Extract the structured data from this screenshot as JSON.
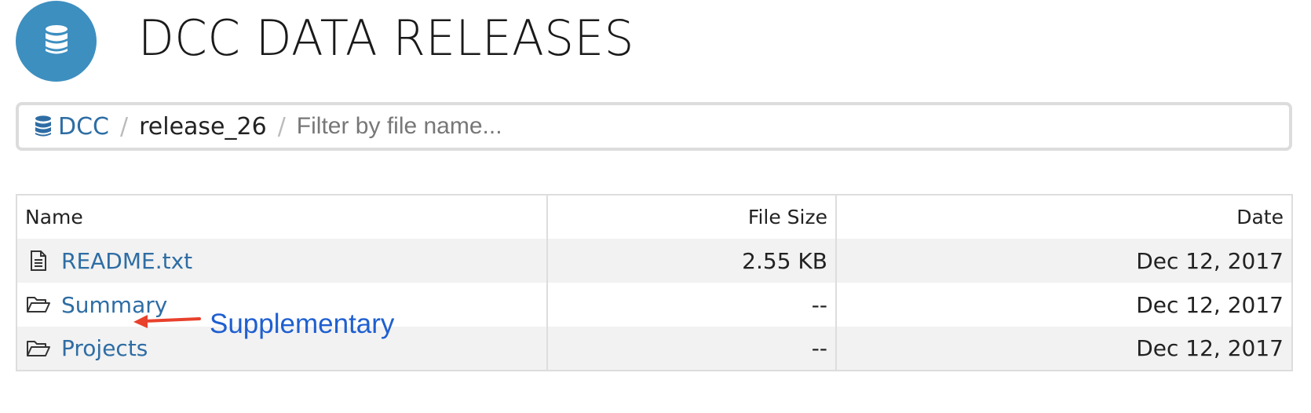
{
  "header": {
    "title": "DCC DATA RELEASES",
    "logo_icon": "database-icon",
    "logo_color": "#3d8fc0"
  },
  "breadcrumb": {
    "root_icon": "database-icon",
    "root_label": "DCC",
    "separator": "/",
    "current": "release_26",
    "filter_placeholder": "Filter by file name..."
  },
  "table": {
    "columns": [
      "Name",
      "File Size",
      "Date"
    ],
    "rows": [
      {
        "icon": "file-text-icon",
        "name": "README.txt",
        "size": "2.55 KB",
        "date": "Dec 12, 2017"
      },
      {
        "icon": "folder-open-icon",
        "name": "Summary",
        "size": "--",
        "date": "Dec 12, 2017"
      },
      {
        "icon": "folder-open-icon",
        "name": "Projects",
        "size": "--",
        "date": "Dec 12, 2017"
      }
    ]
  },
  "annotation": {
    "label": "Supplementary",
    "arrow_color": "#e8412c",
    "text_color": "#1f5fd0"
  },
  "colors": {
    "link": "#2e6da4",
    "row_stripe": "#f2f2f2",
    "border": "#dddddd"
  }
}
